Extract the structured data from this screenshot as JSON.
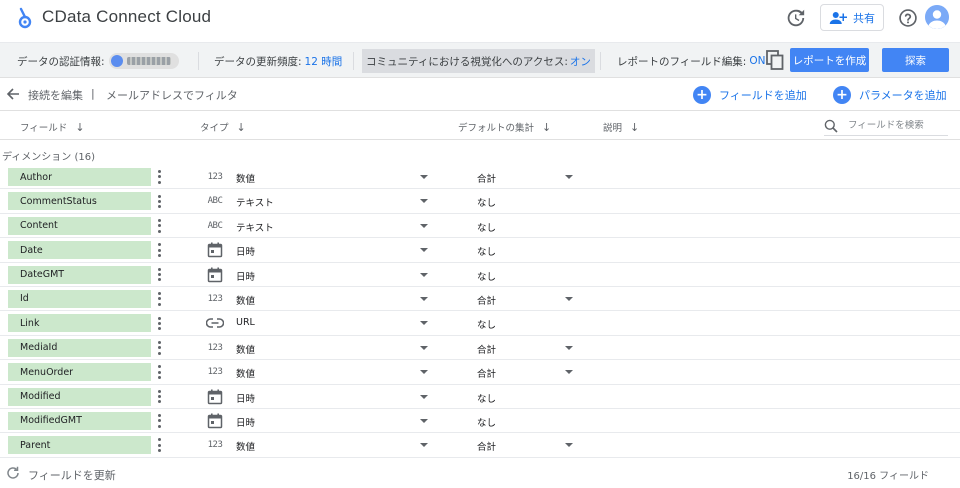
{
  "app": {
    "title": "CData Connect Cloud"
  },
  "header": {
    "share_label": "共有"
  },
  "toolbar": {
    "credentials_label": "データの認証情報:",
    "freshness_label": "データの更新頻度:",
    "freshness_value": "12 時間",
    "community_label": "コミュニティにおける視覚化へのアクセス:",
    "community_value": "オン",
    "field_edit_label": "レポートのフィールド編集:",
    "field_edit_value": "ON",
    "create_report_label": "レポートを作成",
    "explore_label": "探索"
  },
  "editbar": {
    "edit_connection": "接続を編集",
    "separator": "|",
    "filter_by_email": "メールアドレスでフィルタ",
    "add_field": "フィールドを追加",
    "add_parameter": "パラメータを追加"
  },
  "columns": {
    "field": "フィールド",
    "type": "タイプ",
    "default_agg": "デフォルトの集計",
    "description": "説明",
    "search_placeholder": "フィールドを検索"
  },
  "section": {
    "dimensions_label": "ディメンション (16)"
  },
  "rows": [
    {
      "name": "Author",
      "type_icon": "number-icon",
      "type": "数値",
      "agg": "合計",
      "agg_dropdown": true
    },
    {
      "name": "CommentStatus",
      "type_icon": "text-icon",
      "type": "テキスト",
      "agg": "なし",
      "agg_dropdown": false
    },
    {
      "name": "Content",
      "type_icon": "text-icon",
      "type": "テキスト",
      "agg": "なし",
      "agg_dropdown": false
    },
    {
      "name": "Date",
      "type_icon": "calendar-icon",
      "type": "日時",
      "agg": "なし",
      "agg_dropdown": false
    },
    {
      "name": "DateGMT",
      "type_icon": "calendar-icon",
      "type": "日時",
      "agg": "なし",
      "agg_dropdown": false
    },
    {
      "name": "Id",
      "type_icon": "number-icon",
      "type": "数値",
      "agg": "合計",
      "agg_dropdown": true
    },
    {
      "name": "Link",
      "type_icon": "link-icon",
      "type": "URL",
      "agg": "なし",
      "agg_dropdown": false
    },
    {
      "name": "MediaId",
      "type_icon": "number-icon",
      "type": "数値",
      "agg": "合計",
      "agg_dropdown": true
    },
    {
      "name": "MenuOrder",
      "type_icon": "number-icon",
      "type": "数値",
      "agg": "合計",
      "agg_dropdown": true
    },
    {
      "name": "Modified",
      "type_icon": "calendar-icon",
      "type": "日時",
      "agg": "なし",
      "agg_dropdown": false
    },
    {
      "name": "ModifiedGMT",
      "type_icon": "calendar-icon",
      "type": "日時",
      "agg": "なし",
      "agg_dropdown": false
    },
    {
      "name": "Parent",
      "type_icon": "number-icon",
      "type": "数値",
      "agg": "合計",
      "agg_dropdown": true
    }
  ],
  "type_icon_text": {
    "number": "123",
    "text": "ABC"
  },
  "footer": {
    "refresh_label": "フィールドを更新",
    "count_label": "16/16 フィールド"
  },
  "colors": {
    "accent": "#1a73e8",
    "primary_button": "#4285f4",
    "chip": "#cce8cc"
  }
}
